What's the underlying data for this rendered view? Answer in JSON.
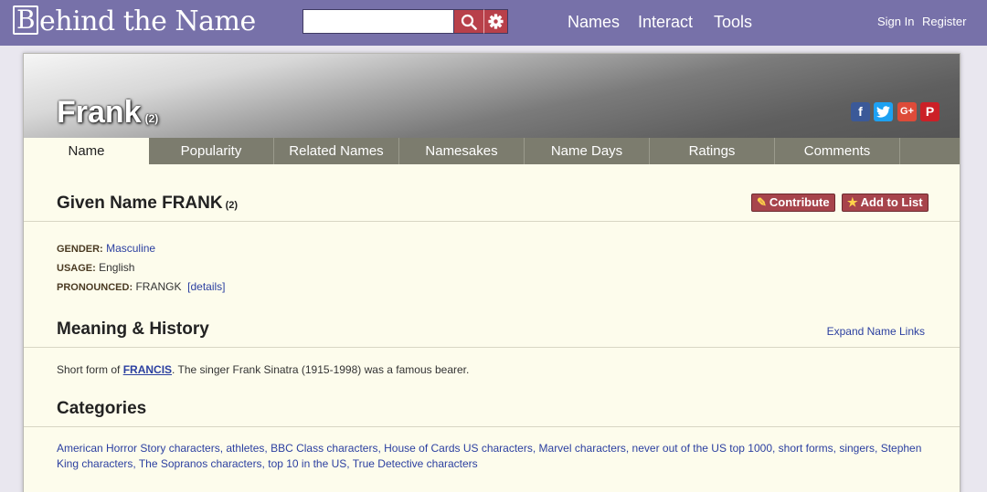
{
  "header": {
    "logo_letter": "B",
    "logo_rest": "ehind the Name",
    "search_placeholder": "",
    "nav": [
      "Names",
      "Interact",
      "Tools"
    ],
    "sign_in": "Sign In",
    "register": "Register"
  },
  "banner": {
    "name": "Frank",
    "number": "(2)",
    "social": [
      "f",
      "t",
      "G+",
      "P"
    ]
  },
  "tabs": [
    "Name",
    "Popularity",
    "Related Names",
    "Namesakes",
    "Name Days",
    "Ratings",
    "Comments"
  ],
  "given": {
    "title": "Given Name FRANK",
    "number": "(2)",
    "contribute": "Contribute",
    "add_to_list": "Add to List",
    "gender_label": "GENDER:",
    "gender": "Masculine",
    "usage_label": "USAGE:",
    "usage": "English",
    "pronounced_label": "PRONOUNCED:",
    "pronounced": "FRANGK",
    "details": "[details]"
  },
  "meaning": {
    "title": "Meaning & History",
    "expand": "Expand Name Links",
    "text_before": "Short form of ",
    "link": "FRANCIS",
    "text_after": ". The singer Frank Sinatra (1915-1998) was a famous bearer."
  },
  "categories": {
    "title": "Categories",
    "text": "American Horror Story characters, athletes, BBC Class characters, House of Cards US characters, Marvel characters, never out of the US top 1000, short forms, singers, Stephen King characters, The Sopranos characters, top 10 in the US, True Detective characters"
  },
  "colors": {
    "topbar": "#7771a9",
    "accent_red": "#b8404a",
    "panel": "#fdfcec",
    "tabbar": "#7c7c6e",
    "link": "#2b3fa0"
  }
}
